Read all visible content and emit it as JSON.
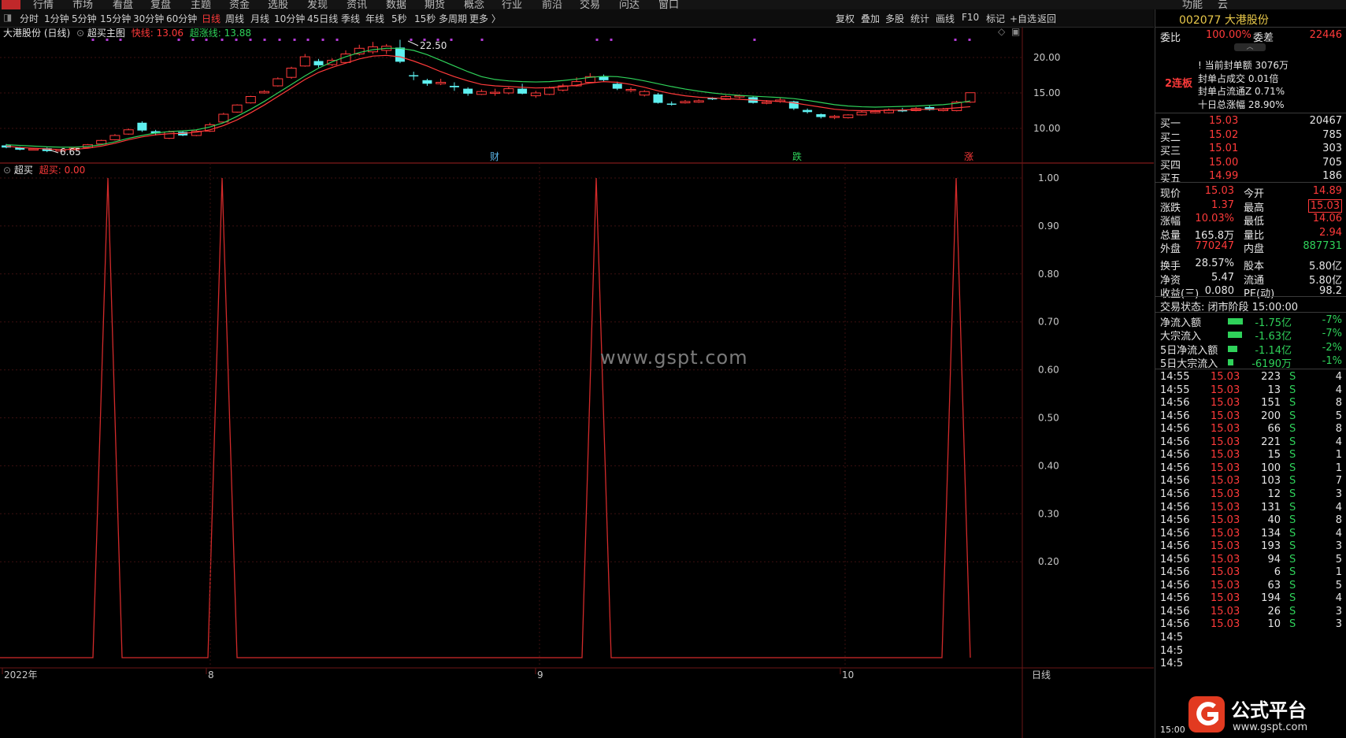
{
  "menu": [
    "行情",
    "市场",
    "看盘",
    "复盘",
    "主题",
    "资金",
    "选股",
    "发现",
    "资讯",
    "数据",
    "期货",
    "概念",
    "行业",
    "前沿",
    "交易",
    "问达",
    "窗口",
    "功能",
    "云"
  ],
  "toolbar": {
    "periods": [
      "分时",
      "1分钟",
      "5分钟",
      "15分钟",
      "30分钟",
      "60分钟",
      "日线",
      "周线",
      "月线",
      "10分钟",
      "45日线",
      "季线",
      "年线",
      "5秒",
      "15秒",
      "多周期",
      "更多 〉"
    ],
    "active": "日线",
    "right": [
      "复权",
      "叠加",
      "多股",
      "统计",
      "画线",
      "F10",
      "标记",
      "+自选",
      "返回"
    ]
  },
  "main_chart": {
    "stock_title": "大港股份 (日线)",
    "indicator_name": "超买主图",
    "fast_label": "快线: 13.06",
    "super_label": "超涨线: 13.88",
    "high_label": "22.50",
    "low_label": "6.65",
    "price_ticks": [
      "20.00",
      "15.00",
      "10.00"
    ],
    "markers": [
      {
        "text": "财",
        "color": "#5ab4e8"
      },
      {
        "text": "跌",
        "color": "#2fd25a"
      },
      {
        "text": "涨",
        "color": "#ff3a3a"
      }
    ]
  },
  "sub_chart": {
    "name": "超买",
    "value_label": "超买: 0.00",
    "y_ticks": [
      "1.00",
      "0.90",
      "0.80",
      "0.70",
      "0.60",
      "0.50",
      "0.40",
      "0.30",
      "0.20"
    ]
  },
  "x_axis": {
    "labels": [
      "2022年",
      "8",
      "9",
      "10"
    ],
    "period_label": "日线"
  },
  "watermark": "www.gspt.com",
  "brand": {
    "name": "公式平台",
    "url": "www.gspt.com"
  },
  "chart_data": [
    {
      "type": "candlestick",
      "title": "大港股份 (日线)",
      "series": [
        {
          "name": "快线",
          "last": 13.06,
          "color": "#ff3a3a"
        },
        {
          "name": "超涨线",
          "last": 13.88,
          "color": "#2fd25a"
        }
      ],
      "candles": [
        {
          "o": 7.6,
          "c": 7.3,
          "h": 7.8,
          "l": 7.2
        },
        {
          "o": 7.3,
          "c": 7.0,
          "h": 7.4,
          "l": 6.9
        },
        {
          "o": 7.0,
          "c": 7.1,
          "h": 7.2,
          "l": 6.9
        },
        {
          "o": 7.2,
          "c": 6.8,
          "h": 7.3,
          "l": 6.65
        },
        {
          "o": 6.8,
          "c": 7.0,
          "h": 7.1,
          "l": 6.7
        },
        {
          "o": 7.0,
          "c": 7.2,
          "h": 7.3,
          "l": 6.9
        },
        {
          "o": 7.3,
          "c": 7.7,
          "h": 7.8,
          "l": 7.2
        },
        {
          "o": 7.8,
          "c": 8.3,
          "h": 8.4,
          "l": 7.7
        },
        {
          "o": 8.4,
          "c": 9.0,
          "h": 9.2,
          "l": 8.3
        },
        {
          "o": 9.2,
          "c": 9.8,
          "h": 10.0,
          "l": 9.1
        },
        {
          "o": 10.8,
          "c": 9.7,
          "h": 11.0,
          "l": 9.5
        },
        {
          "o": 9.6,
          "c": 9.3,
          "h": 9.8,
          "l": 9.0
        },
        {
          "o": 8.6,
          "c": 9.5,
          "h": 9.7,
          "l": 8.5
        },
        {
          "o": 9.5,
          "c": 9.0,
          "h": 9.7,
          "l": 8.9
        },
        {
          "o": 9.0,
          "c": 9.6,
          "h": 9.8,
          "l": 8.9
        },
        {
          "o": 9.6,
          "c": 10.5,
          "h": 10.8,
          "l": 9.5
        },
        {
          "o": 10.9,
          "c": 12.0,
          "h": 12.2,
          "l": 10.8
        },
        {
          "o": 12.3,
          "c": 13.3,
          "h": 13.4,
          "l": 12.2
        },
        {
          "o": 13.6,
          "c": 14.5,
          "h": 14.6,
          "l": 13.5
        },
        {
          "o": 15.0,
          "c": 15.2,
          "h": 15.4,
          "l": 14.9
        },
        {
          "o": 16.0,
          "c": 17.0,
          "h": 17.2,
          "l": 15.9
        },
        {
          "o": 17.2,
          "c": 18.5,
          "h": 18.7,
          "l": 17.0
        },
        {
          "o": 18.8,
          "c": 20.1,
          "h": 20.5,
          "l": 18.7
        },
        {
          "o": 19.5,
          "c": 18.9,
          "h": 19.8,
          "l": 18.6
        },
        {
          "o": 19.0,
          "c": 19.6,
          "h": 19.9,
          "l": 18.8
        },
        {
          "o": 19.3,
          "c": 20.5,
          "h": 21.0,
          "l": 19.2
        },
        {
          "o": 20.5,
          "c": 21.3,
          "h": 21.8,
          "l": 20.3
        },
        {
          "o": 20.8,
          "c": 21.5,
          "h": 22.2,
          "l": 20.5
        },
        {
          "o": 21.0,
          "c": 21.6,
          "h": 21.9,
          "l": 20.5
        },
        {
          "o": 21.4,
          "c": 19.4,
          "h": 22.5,
          "l": 19.2
        },
        {
          "o": 17.5,
          "c": 17.4,
          "h": 18.0,
          "l": 16.8
        },
        {
          "o": 16.8,
          "c": 16.3,
          "h": 17.0,
          "l": 16.0
        },
        {
          "o": 16.3,
          "c": 16.5,
          "h": 17.0,
          "l": 16.1
        },
        {
          "o": 16.0,
          "c": 15.8,
          "h": 16.5,
          "l": 15.3
        },
        {
          "o": 15.6,
          "c": 14.9,
          "h": 15.8,
          "l": 14.6
        },
        {
          "o": 14.8,
          "c": 15.2,
          "h": 15.5,
          "l": 14.7
        },
        {
          "o": 15.0,
          "c": 15.1,
          "h": 15.6,
          "l": 14.6
        },
        {
          "o": 15.0,
          "c": 15.6,
          "h": 15.8,
          "l": 14.8
        },
        {
          "o": 15.6,
          "c": 14.9,
          "h": 16.3,
          "l": 14.8
        },
        {
          "o": 14.6,
          "c": 15.0,
          "h": 15.3,
          "l": 14.3
        },
        {
          "o": 14.8,
          "c": 15.7,
          "h": 15.9,
          "l": 14.7
        },
        {
          "o": 15.4,
          "c": 16.0,
          "h": 16.3,
          "l": 15.2
        },
        {
          "o": 16.0,
          "c": 16.6,
          "h": 17.2,
          "l": 15.9
        },
        {
          "o": 16.5,
          "c": 17.3,
          "h": 17.8,
          "l": 16.4
        },
        {
          "o": 17.3,
          "c": 16.8,
          "h": 17.6,
          "l": 16.6
        },
        {
          "o": 16.3,
          "c": 15.6,
          "h": 16.6,
          "l": 15.4
        },
        {
          "o": 15.4,
          "c": 15.5,
          "h": 15.8,
          "l": 15.1
        },
        {
          "o": 14.7,
          "c": 15.2,
          "h": 15.4,
          "l": 14.5
        },
        {
          "o": 14.8,
          "c": 13.6,
          "h": 15.0,
          "l": 13.5
        },
        {
          "o": 13.5,
          "c": 13.4,
          "h": 13.8,
          "l": 13.2
        },
        {
          "o": 13.6,
          "c": 13.8,
          "h": 14.0,
          "l": 13.5
        },
        {
          "o": 13.7,
          "c": 13.9,
          "h": 14.1,
          "l": 13.6
        },
        {
          "o": 14.3,
          "c": 14.1,
          "h": 14.4,
          "l": 14.0
        },
        {
          "o": 14.1,
          "c": 14.5,
          "h": 14.7,
          "l": 14.0
        },
        {
          "o": 14.5,
          "c": 14.6,
          "h": 14.8,
          "l": 14.2
        },
        {
          "o": 14.4,
          "c": 13.6,
          "h": 14.6,
          "l": 13.5
        },
        {
          "o": 13.6,
          "c": 13.7,
          "h": 14.0,
          "l": 13.4
        },
        {
          "o": 13.8,
          "c": 14.0,
          "h": 14.3,
          "l": 13.6
        },
        {
          "o": 13.8,
          "c": 12.8,
          "h": 13.9,
          "l": 12.6
        },
        {
          "o": 12.6,
          "c": 12.3,
          "h": 12.8,
          "l": 12.1
        },
        {
          "o": 12.0,
          "c": 11.6,
          "h": 12.1,
          "l": 11.4
        },
        {
          "o": 11.6,
          "c": 11.7,
          "h": 11.9,
          "l": 11.3
        },
        {
          "o": 11.5,
          "c": 11.9,
          "h": 12.0,
          "l": 11.4
        },
        {
          "o": 11.9,
          "c": 12.3,
          "h": 12.5,
          "l": 11.8
        },
        {
          "o": 12.2,
          "c": 12.4,
          "h": 12.6,
          "l": 12.1
        },
        {
          "o": 12.2,
          "c": 12.6,
          "h": 12.8,
          "l": 12.1
        },
        {
          "o": 12.6,
          "c": 12.4,
          "h": 12.9,
          "l": 12.3
        },
        {
          "o": 12.5,
          "c": 12.8,
          "h": 13.0,
          "l": 12.4
        },
        {
          "o": 13.0,
          "c": 12.6,
          "h": 13.2,
          "l": 12.5
        },
        {
          "o": 12.5,
          "c": 12.7,
          "h": 12.9,
          "l": 12.4
        },
        {
          "o": 12.5,
          "c": 13.7,
          "h": 13.9,
          "l": 12.4
        },
        {
          "o": 13.7,
          "c": 15.03,
          "h": 15.03,
          "l": 13.6
        }
      ],
      "fast_line": [
        7.5,
        7.3,
        7.2,
        7.1,
        7.0,
        7.05,
        7.2,
        7.5,
        7.9,
        8.4,
        8.8,
        9.1,
        9.25,
        9.3,
        9.45,
        9.8,
        10.4,
        11.2,
        12.2,
        13.3,
        14.5,
        15.7,
        16.9,
        17.9,
        18.6,
        19.2,
        19.8,
        20.2,
        20.3,
        20.1,
        19.5,
        18.8,
        18.0,
        17.3,
        16.7,
        16.2,
        16.0,
        15.9,
        15.8,
        15.7,
        15.75,
        15.9,
        16.1,
        16.4,
        16.6,
        16.5,
        16.2,
        15.8,
        15.3,
        14.9,
        14.6,
        14.4,
        14.3,
        14.2,
        14.1,
        14.0,
        13.9,
        13.8,
        13.6,
        13.3,
        13.0,
        12.7,
        12.55,
        12.5,
        12.5,
        12.55,
        12.6,
        12.65,
        12.7,
        12.75,
        12.9,
        13.06
      ],
      "super_line": [
        7.7,
        7.6,
        7.5,
        7.4,
        7.35,
        7.35,
        7.45,
        7.7,
        8.1,
        8.6,
        9.0,
        9.35,
        9.55,
        9.65,
        9.8,
        10.2,
        10.8,
        11.7,
        12.7,
        13.8,
        15.0,
        16.2,
        17.4,
        18.5,
        19.4,
        20.1,
        20.7,
        21.1,
        21.3,
        21.3,
        21.0,
        20.4,
        19.6,
        18.8,
        18.0,
        17.3,
        16.9,
        16.7,
        16.6,
        16.55,
        16.6,
        16.75,
        16.95,
        17.2,
        17.35,
        17.3,
        17.05,
        16.7,
        16.3,
        15.9,
        15.55,
        15.25,
        15.0,
        14.8,
        14.65,
        14.55,
        14.45,
        14.35,
        14.2,
        13.95,
        13.65,
        13.35,
        13.15,
        13.05,
        13.0,
        13.05,
        13.1,
        13.15,
        13.25,
        13.35,
        13.55,
        13.88
      ],
      "ylim": [
        6.0,
        24.0
      ]
    },
    {
      "type": "line",
      "title": "超买",
      "ylim": [
        0,
        1.0
      ],
      "pulses": [
        {
          "start": 118,
          "peak": 137,
          "end": 155
        },
        {
          "start": 264,
          "peak": 282,
          "end": 301
        },
        {
          "start": 739,
          "peak": 757,
          "end": 776
        },
        {
          "start": 1196,
          "peak": 1214,
          "end": 1232
        }
      ]
    }
  ],
  "panel": {
    "header": {
      "code": "002077",
      "name": "大港股份"
    },
    "weibi": {
      "label": "委比",
      "value": "100.00%",
      "diff_label": "委差",
      "diff": "22446"
    },
    "limit": {
      "tag": "2连板",
      "rows": [
        "! 当前封单额 3076万",
        "封单占成交 0.01倍",
        "封单占流通Z 0.71%",
        "十日总涨幅 28.90%"
      ]
    },
    "buy": [
      {
        "label": "买一",
        "price": "15.03",
        "vol": "20467"
      },
      {
        "label": "买二",
        "price": "15.02",
        "vol": "785"
      },
      {
        "label": "买三",
        "price": "15.01",
        "vol": "303"
      },
      {
        "label": "买四",
        "price": "15.00",
        "vol": "705"
      },
      {
        "label": "买五",
        "price": "14.99",
        "vol": "186"
      }
    ],
    "quote": [
      {
        "l1": "现价",
        "v1": "15.03",
        "c1": "red",
        "l2": "今开",
        "v2": "14.89",
        "c2": "red"
      },
      {
        "l1": "涨跌",
        "v1": "1.37",
        "c1": "red",
        "l2": "最高",
        "v2": "15.03",
        "c2": "red"
      },
      {
        "l1": "涨幅",
        "v1": "10.03%",
        "c1": "red",
        "l2": "最低",
        "v2": "14.06",
        "c2": "red"
      },
      {
        "l1": "总量",
        "v1": "165.8万",
        "c1": "white",
        "l2": "量比",
        "v2": "2.94",
        "c2": "red"
      },
      {
        "l1": "外盘",
        "v1": "770247",
        "c1": "red",
        "l2": "内盘",
        "v2": "887731",
        "c2": "green"
      },
      {
        "l1": "换手",
        "v1": "28.57%",
        "c1": "white",
        "l2": "股本",
        "v2": "5.80亿",
        "c2": "white"
      },
      {
        "l1": "净资",
        "v1": "5.47",
        "c1": "white",
        "l2": "流通",
        "v2": "5.80亿",
        "c2": "white"
      },
      {
        "l1": "收益(三)",
        "v1": "0.080",
        "c1": "white",
        "l2": "PE(动)",
        "v2": "98.2",
        "c2": "white"
      }
    ],
    "trade_status": "交易状态: 闭市阶段 15:00:00",
    "flows": [
      {
        "label": "净流入额",
        "value": "-1.75亿",
        "pct": "-7%",
        "bar": 0.85
      },
      {
        "label": "大宗流入",
        "value": "-1.63亿",
        "pct": "-7%",
        "bar": 0.8
      },
      {
        "label": "5日净流入额",
        "value": "-1.14亿",
        "pct": "-2%",
        "bar": 0.55
      },
      {
        "label": "5日大宗流入",
        "value": "-6190万",
        "pct": "-1%",
        "bar": 0.3
      }
    ],
    "ticks": [
      {
        "t": "14:55",
        "p": "15.03",
        "v": "223",
        "s": "S",
        "n": "4"
      },
      {
        "t": "14:55",
        "p": "15.03",
        "v": "13",
        "s": "S",
        "n": "4"
      },
      {
        "t": "14:56",
        "p": "15.03",
        "v": "151",
        "s": "S",
        "n": "8"
      },
      {
        "t": "14:56",
        "p": "15.03",
        "v": "200",
        "s": "S",
        "n": "5"
      },
      {
        "t": "14:56",
        "p": "15.03",
        "v": "66",
        "s": "S",
        "n": "8"
      },
      {
        "t": "14:56",
        "p": "15.03",
        "v": "221",
        "s": "S",
        "n": "4"
      },
      {
        "t": "14:56",
        "p": "15.03",
        "v": "15",
        "s": "S",
        "n": "1"
      },
      {
        "t": "14:56",
        "p": "15.03",
        "v": "100",
        "s": "S",
        "n": "1"
      },
      {
        "t": "14:56",
        "p": "15.03",
        "v": "103",
        "s": "S",
        "n": "7"
      },
      {
        "t": "14:56",
        "p": "15.03",
        "v": "12",
        "s": "S",
        "n": "3"
      },
      {
        "t": "14:56",
        "p": "15.03",
        "v": "131",
        "s": "S",
        "n": "4"
      },
      {
        "t": "14:56",
        "p": "15.03",
        "v": "40",
        "s": "S",
        "n": "8"
      },
      {
        "t": "14:56",
        "p": "15.03",
        "v": "134",
        "s": "S",
        "n": "4"
      },
      {
        "t": "14:56",
        "p": "15.03",
        "v": "193",
        "s": "S",
        "n": "3"
      },
      {
        "t": "14:56",
        "p": "15.03",
        "v": "94",
        "s": "S",
        "n": "5"
      },
      {
        "t": "14:56",
        "p": "15.03",
        "v": "6",
        "s": "S",
        "n": "1"
      },
      {
        "t": "14:56",
        "p": "15.03",
        "v": "63",
        "s": "S",
        "n": "5"
      },
      {
        "t": "14:56",
        "p": "15.03",
        "v": "194",
        "s": "S",
        "n": "4"
      },
      {
        "t": "14:56",
        "p": "15.03",
        "v": "26",
        "s": "S",
        "n": "3"
      },
      {
        "t": "14:56",
        "p": "15.03",
        "v": "10",
        "s": "S",
        "n": "3"
      },
      {
        "t": "14:5",
        "p": "",
        "v": "",
        "s": "",
        "n": ""
      },
      {
        "t": "14:5",
        "p": "",
        "v": "",
        "s": "",
        "n": ""
      },
      {
        "t": "14:5",
        "p": "",
        "v": "",
        "s": "",
        "n": ""
      }
    ],
    "bottom_time": "15:00"
  },
  "colors": {
    "up": "#ff3a3a",
    "down": "#5ef0f0",
    "fast": "#ff3a3a",
    "super": "#2fd25a",
    "grid": "#3c1010"
  }
}
